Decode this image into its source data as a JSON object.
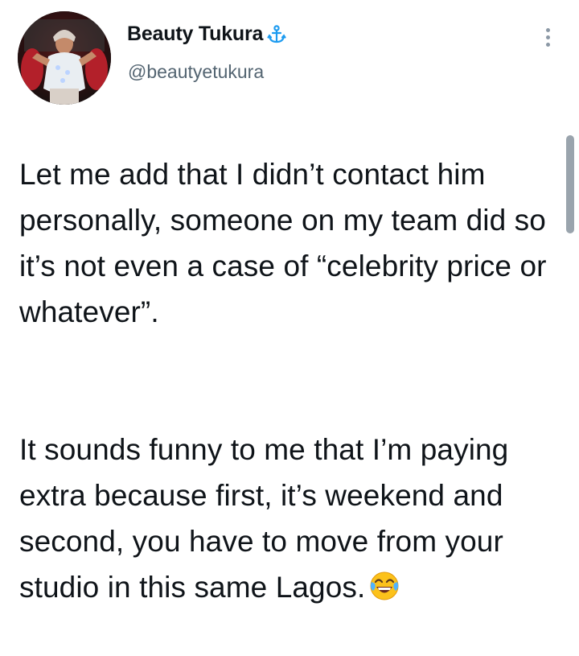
{
  "tweet": {
    "author": {
      "display_name": "Beauty Tukura",
      "handle": "@beautyetukura",
      "badge_icon": "anchor-icon",
      "avatar_icon": "profile-photo"
    },
    "more_icon": "more-options-icon",
    "paragraphs": [
      "Let me add that I didn’t contact him personally, someone on my team did so it’s not even a case of “celebrity price or whatever”.",
      "It sounds funny to me that I’m paying extra because first, it’s weekend and second, you have to move from your studio in this same Lagos."
    ],
    "trailing_emoji": "face-with-tears-of-joy-emoji"
  },
  "colors": {
    "text_primary": "#0f1419",
    "text_secondary": "#536471",
    "badge_blue": "#1d9bf0",
    "scrollbar": "#9aa4ad"
  }
}
